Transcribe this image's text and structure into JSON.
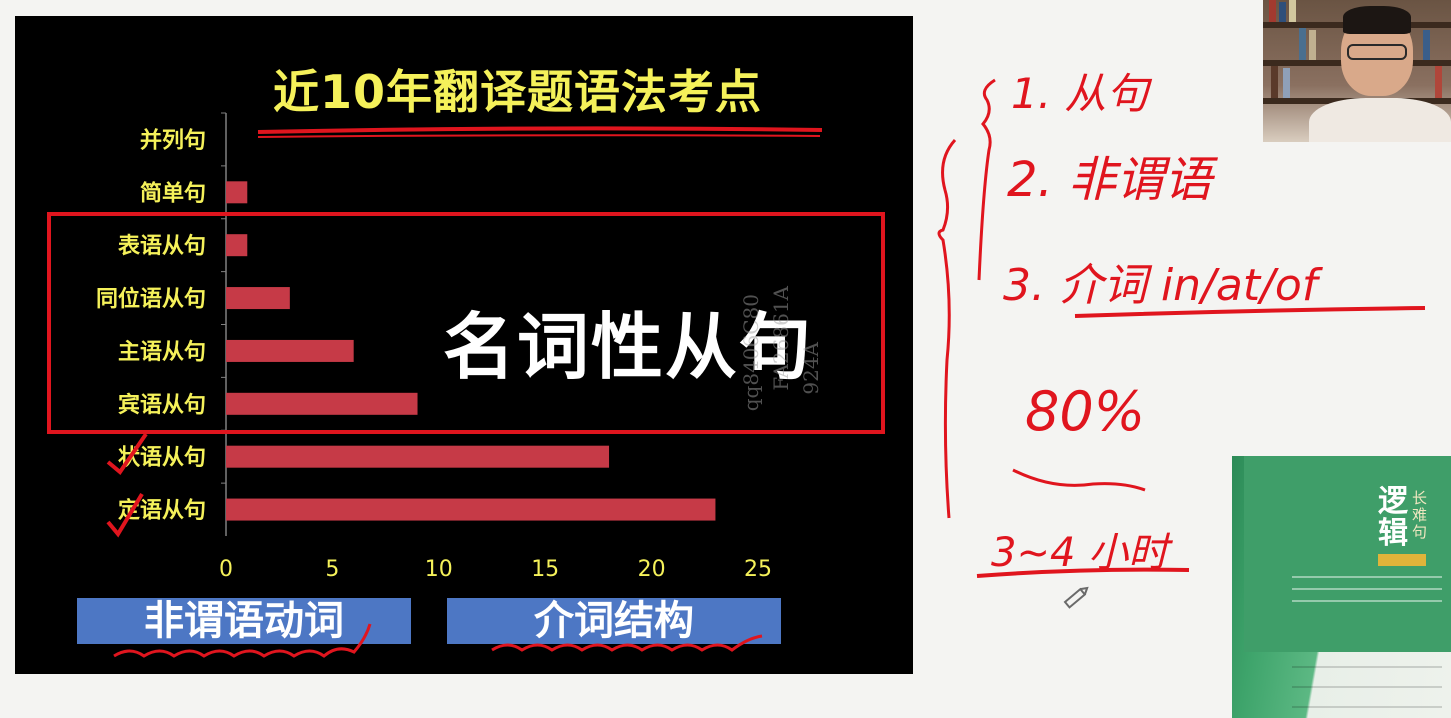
{
  "slide": {
    "title": "近10年翻译题语法考点",
    "highlight_label": "名词性从句",
    "buttons": [
      {
        "label": "非谓语动词"
      },
      {
        "label": "介词结构"
      }
    ],
    "watermark": [
      "qq8406C80",
      "FA26861A",
      "924A"
    ]
  },
  "chart_data": {
    "type": "bar",
    "orientation": "horizontal",
    "title": "近10年翻译题语法考点",
    "categories": [
      "并列句",
      "简单句",
      "表语从句",
      "同位语从句",
      "主语从句",
      "宾语从句",
      "状语从句",
      "定语从句"
    ],
    "values": [
      0,
      1,
      1,
      3,
      6,
      9,
      18,
      23
    ],
    "xlim": [
      0,
      25
    ],
    "xticks": [
      "0",
      "5",
      "10",
      "15",
      "20",
      "25"
    ],
    "grid": false,
    "legend": "none",
    "colors": {
      "bar": "#c63a47",
      "axis_text": "#f5f15a",
      "category_text": "#f5f15a"
    }
  },
  "notes": {
    "line1": "1. 从句",
    "line2": "2. 非谓语",
    "line3": "3. 介词 in/at/of",
    "percent": "80%",
    "hours": "3~4 小时",
    "pen_color": "#e0151e"
  },
  "book": {
    "title": "逻辑",
    "subtitle": "长难句"
  },
  "icons": {
    "pencil": "pencil-icon"
  }
}
